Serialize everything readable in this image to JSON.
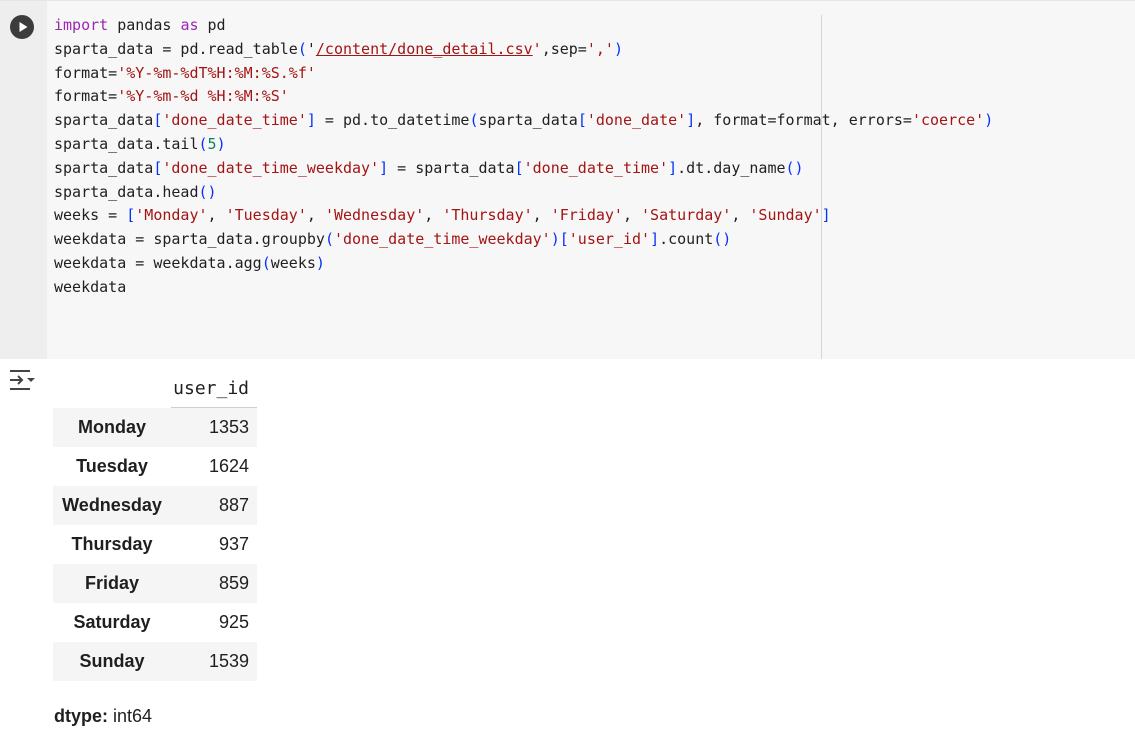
{
  "cell": {
    "code_lines": [
      [
        {
          "t": "import",
          "c": "kw"
        },
        {
          "t": " pandas "
        },
        {
          "t": "as",
          "c": "kw"
        },
        {
          "t": " pd"
        }
      ],
      [
        {
          "t": "sparta_data = pd.read_table("
        },
        {
          "t": "(",
          "c": "hide"
        }
      ],
      [],
      [],
      [],
      [],
      [],
      [],
      [],
      [],
      [],
      []
    ]
  },
  "output": {
    "column_header": "user_id",
    "rows": [
      {
        "label": "Monday",
        "value": "1353"
      },
      {
        "label": "Tuesday",
        "value": "1624"
      },
      {
        "label": "Wednesday",
        "value": "887"
      },
      {
        "label": "Thursday",
        "value": "937"
      },
      {
        "label": "Friday",
        "value": "859"
      },
      {
        "label": "Saturday",
        "value": "925"
      },
      {
        "label": "Sunday",
        "value": "1539"
      }
    ],
    "dtype_label": "dtype:",
    "dtype_value": "int64"
  },
  "icons": {
    "run": "play-circle-icon",
    "output_toggle": "output-collapse-icon"
  }
}
